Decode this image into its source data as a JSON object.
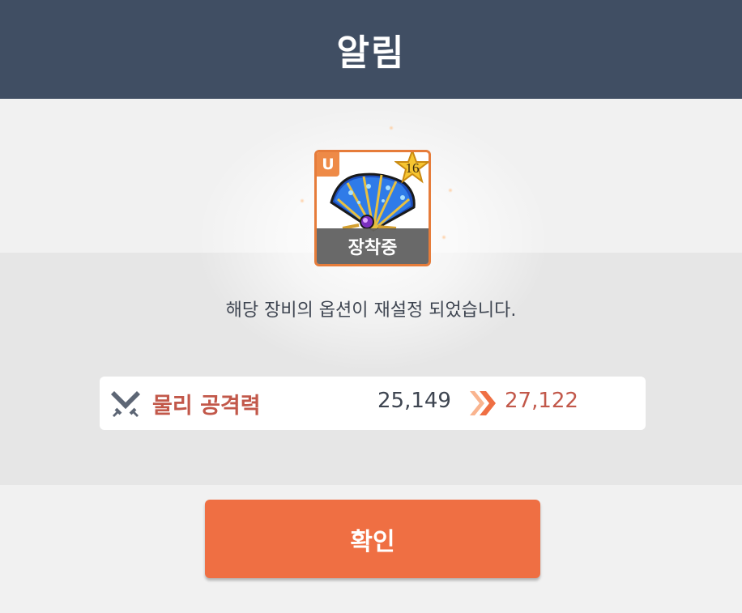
{
  "dialog": {
    "title": "알림"
  },
  "item": {
    "grade": "U",
    "star_level": "16",
    "icon": "fan-icon",
    "equipped_label": "장착중"
  },
  "message": "해당 장비의 옵션이 재설정 되었습니다.",
  "stat": {
    "icon": "crossed-swords-icon",
    "name": "물리 공격력",
    "old_value": "25,149",
    "new_value": "27,122"
  },
  "confirm_button_label": "확인",
  "colors": {
    "header_bg": "#404e63",
    "accent_orange": "#ef6f43",
    "stat_red": "#c2584a",
    "grade_badge": "#ee8a47"
  }
}
